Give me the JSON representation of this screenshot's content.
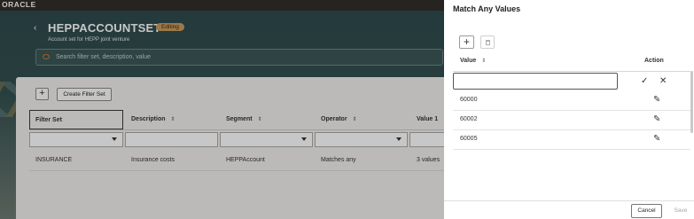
{
  "header": {
    "logo": "ORACLE",
    "back_icon": "chevron-left-icon",
    "title": "HEPPACCOUNTSET",
    "badge": "Editing",
    "subtitle": "Account set for HEPP joint venture",
    "search_placeholder": "Search filter set, description, value"
  },
  "toolbar": {
    "add_label": "+",
    "create_label": "Create Filter Set"
  },
  "table": {
    "columns": [
      "Filter Set",
      "Description",
      "Segment",
      "Operator",
      "Value 1"
    ],
    "rows": [
      {
        "filter_set": "INSURANCE",
        "description": "Insurance costs",
        "segment": "HEPPAccount",
        "operator": "Matches any",
        "value1": "3 values"
      }
    ]
  },
  "drawer": {
    "title": "Match Any Values",
    "add_label": "+",
    "col_value": "Value",
    "col_action": "Action",
    "input_value": "",
    "values": [
      "60000",
      "60002",
      "60005"
    ],
    "cancel_label": "Cancel",
    "save_label": "Save"
  },
  "colors": {
    "topbar": "#312d2a",
    "band": "#2f4a4d",
    "badge": "#c99a5b",
    "accent_search_icon": "#d47b3b"
  }
}
